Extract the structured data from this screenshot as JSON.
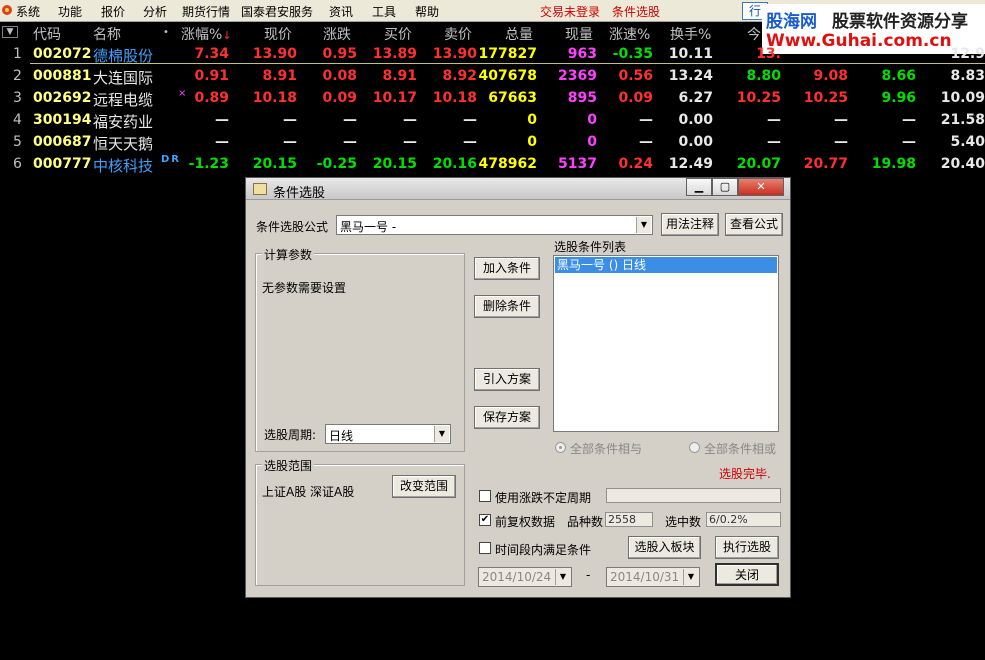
{
  "menu": {
    "items": [
      "系统",
      "功能",
      "报价",
      "分析",
      "期货行情",
      "国泰君安服务",
      "资讯",
      "工具",
      "帮助"
    ],
    "status_login": "交易未登录",
    "status_select": "条件选股",
    "top_button": "行"
  },
  "logo": {
    "line1_brand": "股海网",
    "line1_text": "股票软件资源分享",
    "line2": "Www.Guhai.com.cn"
  },
  "table": {
    "headers": [
      "代码",
      "名称",
      "•",
      "涨幅%",
      "现价",
      "涨跌",
      "买价",
      "卖价",
      "总量",
      "现量",
      "涨速%",
      "换手%",
      "今"
    ],
    "sort_arrow": "↓",
    "rows": [
      {
        "idx": "1",
        "code": "002072",
        "name": "德棉股份",
        "mark": "",
        "chg_pct": "7.34",
        "price": "13.90",
        "chg": "0.95",
        "bid": "13.89",
        "ask": "13.90",
        "vol": "177827",
        "cur_vol": "963",
        "speed": "-0.35",
        "turnover": "10.11",
        "c1": "13.",
        "c2": "",
        "c3": "",
        "c4": "12.9"
      },
      {
        "idx": "2",
        "code": "000881",
        "name": "大连国际",
        "mark": "",
        "chg_pct": "0.91",
        "price": "8.91",
        "chg": "0.08",
        "bid": "8.91",
        "ask": "8.92",
        "vol": "407678",
        "cur_vol": "2369",
        "speed": "0.56",
        "turnover": "13.24",
        "c1": "8.80",
        "c2": "9.08",
        "c3": "8.66",
        "c4": "8.83"
      },
      {
        "idx": "3",
        "code": "002692",
        "name": "远程电缆",
        "mark": "×",
        "chg_pct": "0.89",
        "price": "10.18",
        "chg": "0.09",
        "bid": "10.17",
        "ask": "10.18",
        "vol": "67663",
        "cur_vol": "895",
        "speed": "0.09",
        "turnover": "6.27",
        "c1": "10.25",
        "c2": "10.25",
        "c3": "9.96",
        "c4": "10.09"
      },
      {
        "idx": "4",
        "code": "300194",
        "name": "福安药业",
        "mark": "",
        "chg_pct": "—",
        "price": "—",
        "chg": "—",
        "bid": "—",
        "ask": "—",
        "vol": "0",
        "cur_vol": "0",
        "speed": "—",
        "turnover": "0.00",
        "c1": "—",
        "c2": "—",
        "c3": "—",
        "c4": "21.58"
      },
      {
        "idx": "5",
        "code": "000687",
        "name": "恒天天鹅",
        "mark": "",
        "chg_pct": "—",
        "price": "—",
        "chg": "—",
        "bid": "—",
        "ask": "—",
        "vol": "0",
        "cur_vol": "0",
        "speed": "—",
        "turnover": "0.00",
        "c1": "—",
        "c2": "—",
        "c3": "—",
        "c4": "5.40"
      },
      {
        "idx": "6",
        "code": "000777",
        "name": "中核科技",
        "mark": "DR",
        "chg_pct": "-1.23",
        "price": "20.15",
        "chg": "-0.25",
        "bid": "20.15",
        "ask": "20.16",
        "vol": "478962",
        "cur_vol": "5137",
        "speed": "0.24",
        "turnover": "12.49",
        "c1": "20.07",
        "c2": "20.77",
        "c3": "19.98",
        "c4": "20.40"
      }
    ]
  },
  "dialog": {
    "title": "条件选股",
    "formula_label": "条件选股公式",
    "formula_value": "黑马一号 -",
    "btn_usage": "用法注释",
    "btn_view_formula": "查看公式",
    "params_group": "计算参数",
    "params_text": "无参数需要设置",
    "period_label": "选股周期:",
    "period_value": "日线",
    "btn_add": "加入条件",
    "btn_delete": "删除条件",
    "btn_import": "引入方案",
    "btn_save": "保存方案",
    "list_label": "选股条件列表",
    "list_items": [
      "黑马一号 () 日线"
    ],
    "radio_and": "全部条件相与",
    "radio_or": "全部条件相或",
    "status": "选股完毕.",
    "range_group": "选股范围",
    "range_text": "上证A股 深证A股",
    "btn_change_range": "改变范围",
    "chk_period": "使用涨跌不定周期",
    "chk_adjust": "前复权数据",
    "count_label": "品种数",
    "count_value": "2558",
    "selected_label": "选中数",
    "selected_value": "6/0.2%",
    "chk_time": "时间段内满足条件",
    "btn_to_block": "选股入板块",
    "btn_execute": "执行选股",
    "date_from": "2014/10/24",
    "date_sep": "-",
    "date_to": "2014/10/31",
    "btn_close": "关闭"
  },
  "colors": {
    "red": "#ff3030",
    "green": "#00e000",
    "yellow": "#ffff00",
    "magenta": "#ff40ff",
    "white": "#e8e8e8"
  }
}
